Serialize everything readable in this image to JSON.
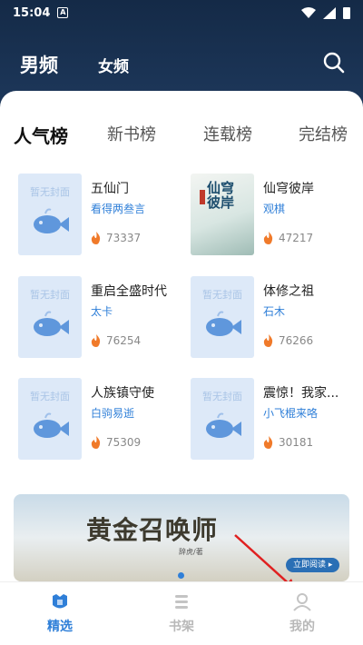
{
  "status_bar": {
    "time": "15:04",
    "notif": "A"
  },
  "top_tabs": {
    "active": "男频",
    "inactive": "女频"
  },
  "rank_tabs": [
    "人气榜",
    "新书榜",
    "连载榜",
    "完结榜"
  ],
  "no_cover_text": "暂无封面",
  "books": [
    {
      "title": "五仙门",
      "author": "看得两叁言",
      "heat": "73337"
    },
    {
      "title": "仙穹彼岸",
      "author": "观棋",
      "heat": "47217",
      "cover_title": "仙穹彼岸"
    },
    {
      "title": "重启全盛时代",
      "author": "太卡",
      "heat": "76254"
    },
    {
      "title": "体修之祖",
      "author": "石木",
      "heat": "76266"
    },
    {
      "title": "人族镇守使",
      "author": "白驹易逝",
      "heat": "75309"
    },
    {
      "title": "震惊！我家...",
      "author": "小飞棍来咯",
      "heat": "30181"
    }
  ],
  "banner": {
    "title": "黄金召唤师",
    "author": "辞虎/著",
    "read_button": "立即阅读 ▸"
  },
  "bottom_nav": [
    "精选",
    "书架",
    "我的"
  ],
  "colors": {
    "accent": "#2f7fd8",
    "header": "#1a3354",
    "flame": "#f07a2a"
  }
}
